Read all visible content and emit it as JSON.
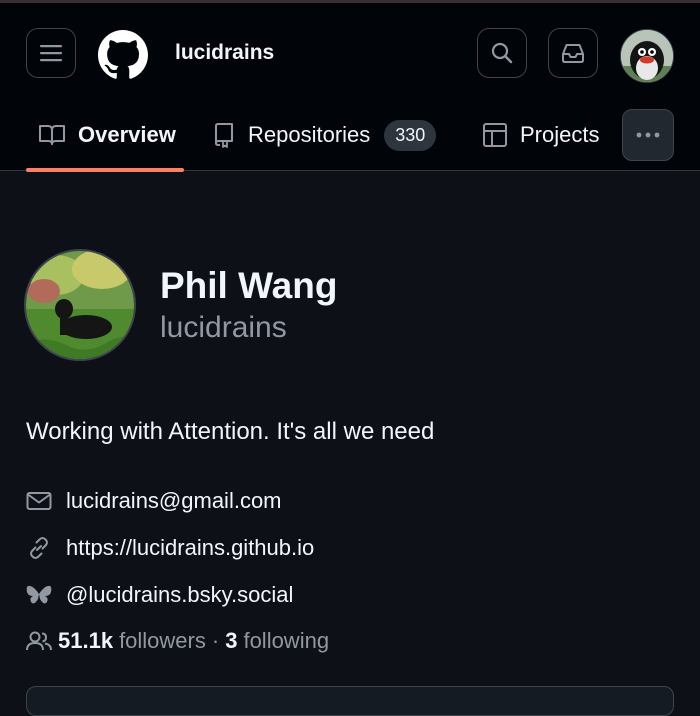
{
  "header": {
    "username": "lucidrains",
    "menu_icon": "hamburger-menu-icon",
    "logo_icon": "github-logo-icon",
    "search_icon": "search-icon",
    "inbox_icon": "inbox-icon"
  },
  "tabs": [
    {
      "label": "Overview",
      "icon": "book-icon",
      "active": true
    },
    {
      "label": "Repositories",
      "icon": "repo-icon",
      "count": "330"
    },
    {
      "label": "Projects",
      "icon": "table-icon"
    }
  ],
  "profile": {
    "name": "Phil Wang",
    "login": "lucidrains",
    "bio": "Working with Attention. It's all we need",
    "email": "lucidrains@gmail.com",
    "website": "https://lucidrains.github.io",
    "bluesky": "@lucidrains.bsky.social",
    "followers_count": "51.1k",
    "followers_label": "followers",
    "separator": "·",
    "following_count": "3",
    "following_label": "following"
  },
  "colors": {
    "background": "#0d1117",
    "header_bg": "#010409",
    "accent_underline": "#f78166",
    "muted_text": "#9198a1"
  }
}
